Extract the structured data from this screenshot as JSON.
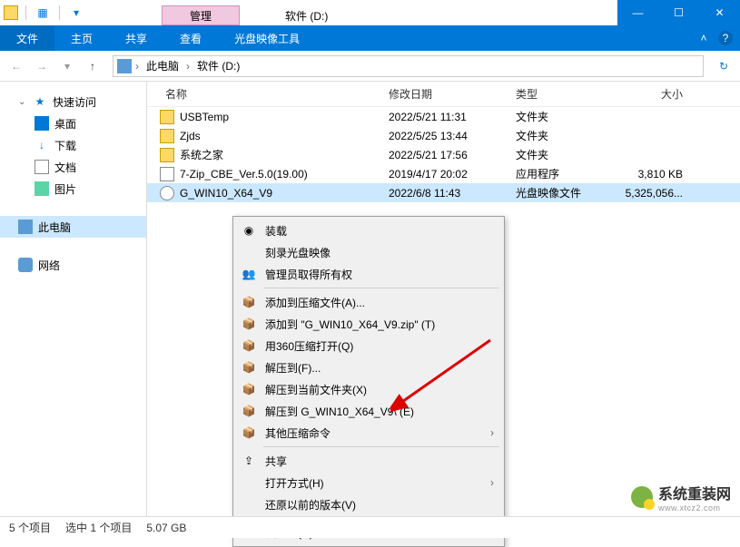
{
  "titlebar": {
    "manage_tab": "管理",
    "path_tab": "软件 (D:)"
  },
  "winctrl": {
    "min": "—",
    "max": "☐",
    "close": "✕"
  },
  "ribbon": {
    "file": "文件",
    "home": "主页",
    "share": "共享",
    "view": "查看",
    "disc": "光盘映像工具"
  },
  "breadcrumb": {
    "this_pc": "此电脑",
    "drive": "软件 (D:)"
  },
  "sidebar": {
    "quick_access": "快速访问",
    "desktop": "桌面",
    "downloads": "下载",
    "documents": "文档",
    "pictures": "图片",
    "this_pc": "此电脑",
    "network": "网络"
  },
  "columns": {
    "name": "名称",
    "date": "修改日期",
    "type": "类型",
    "size": "大小"
  },
  "rows": [
    {
      "name": "USBTemp",
      "date": "2022/5/21 11:31",
      "type": "文件夹",
      "size": "",
      "icon": "folder",
      "selected": false
    },
    {
      "name": "Zjds",
      "date": "2022/5/25 13:44",
      "type": "文件夹",
      "size": "",
      "icon": "folder",
      "selected": false
    },
    {
      "name": "系统之家",
      "date": "2022/5/21 17:56",
      "type": "文件夹",
      "size": "",
      "icon": "folder",
      "selected": false
    },
    {
      "name": "7-Zip_CBE_Ver.5.0(19.00)",
      "date": "2019/4/17 20:02",
      "type": "应用程序",
      "size": "3,810 KB",
      "icon": "exe",
      "selected": false
    },
    {
      "name": "G_WIN10_X64_V9",
      "date": "2022/6/8 11:43",
      "type": "光盘映像文件",
      "size": "5,325,056...",
      "icon": "iso",
      "selected": true
    }
  ],
  "menu": {
    "mount": "装载",
    "burn": "刻录光盘映像",
    "admin": "管理员取得所有权",
    "add_archive": "添加到压缩文件(A)...",
    "add_zip": "添加到 \"G_WIN10_X64_V9.zip\" (T)",
    "open_360": "用360压缩打开(Q)",
    "extract_to": "解压到(F)...",
    "extract_here": "解压到当前文件夹(X)",
    "extract_named": "解压到 G_WIN10_X64_V9\\ (E)",
    "other_compress": "其他压缩命令",
    "share": "共享",
    "open_with": "打开方式(H)",
    "restore": "还原以前的版本(V)",
    "send_to": "发送到(N)"
  },
  "status": {
    "items": "5 个项目",
    "selected": "选中 1 个项目",
    "size": "5.07 GB"
  },
  "watermark": {
    "title": "系统重装网",
    "url": "www.xtcz2.com"
  }
}
